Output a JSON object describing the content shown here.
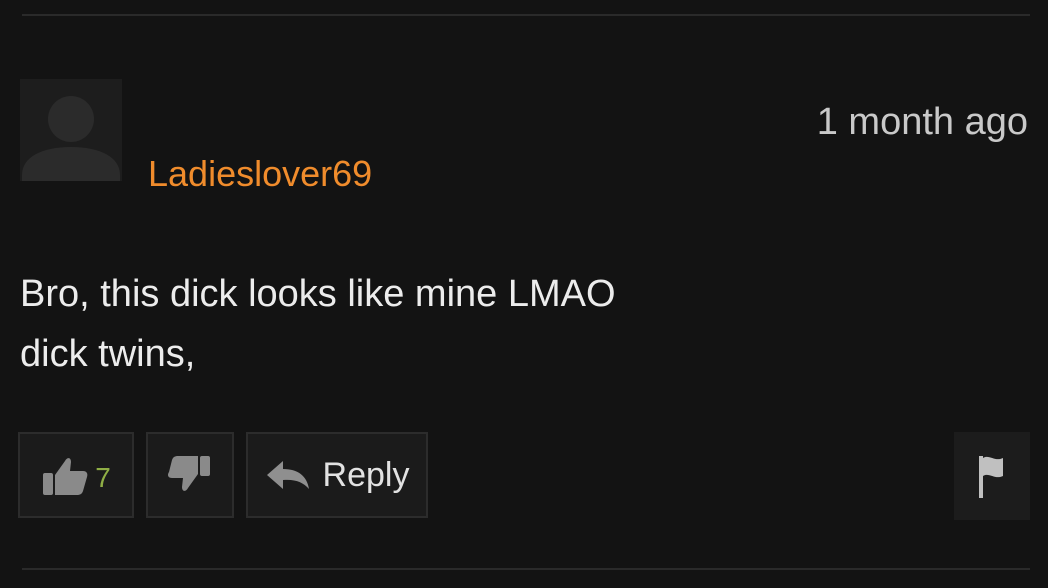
{
  "comment": {
    "username": "Ladieslover69",
    "timestamp": "1 month ago",
    "body_lines": [
      "Bro, this dick looks like mine LMAO",
      "dick twins,"
    ],
    "likes": "7",
    "reply_label": "Reply"
  },
  "colors": {
    "background": "#131313",
    "username": "#f08c2c",
    "like_count": "#8fae45",
    "text": "#ececec"
  },
  "icons": {
    "avatar": "default-user-silhouette",
    "like": "thumbs-up-icon",
    "dislike": "thumbs-down-icon",
    "reply": "reply-arrow-icon",
    "flag": "flag-icon"
  }
}
